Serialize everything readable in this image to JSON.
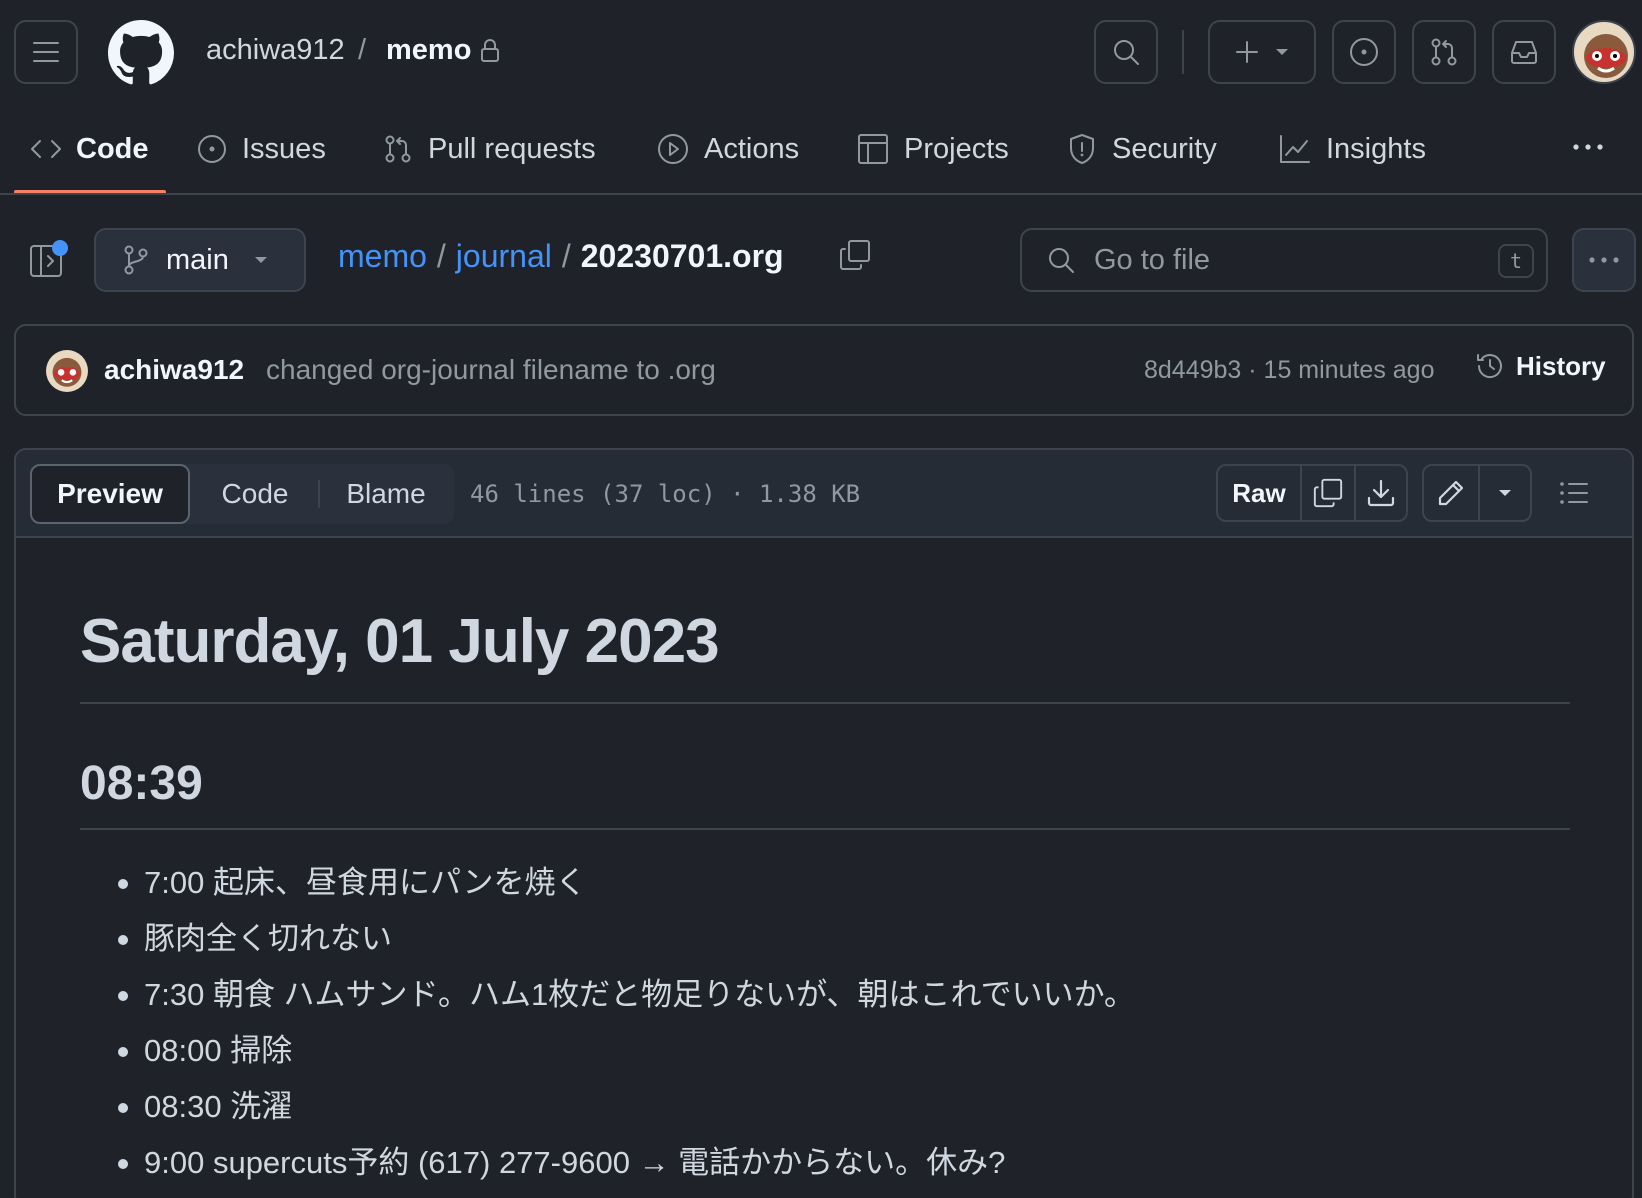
{
  "header": {
    "owner": "achiwa912",
    "separator": "/",
    "repo": "memo"
  },
  "nav": {
    "tabs": [
      {
        "label": "Code",
        "icon": "code-icon",
        "active": true
      },
      {
        "label": "Issues",
        "icon": "issue-opened-icon"
      },
      {
        "label": "Pull requests",
        "icon": "git-pull-request-icon"
      },
      {
        "label": "Actions",
        "icon": "play-icon"
      },
      {
        "label": "Projects",
        "icon": "table-icon"
      },
      {
        "label": "Security",
        "icon": "shield-icon"
      },
      {
        "label": "Insights",
        "icon": "graph-icon"
      }
    ]
  },
  "file_nav": {
    "branch": "main",
    "path": [
      "memo",
      "journal"
    ],
    "path_sep": "/",
    "filename": "20230701.org",
    "goto_placeholder": "Go to file",
    "goto_shortcut": "t"
  },
  "commit": {
    "author": "achiwa912",
    "message": "changed org-journal filename to .org",
    "meta": "8d449b3 · 15 minutes ago",
    "history_label": "History"
  },
  "file_toolbar": {
    "preview_label": "Preview",
    "code_label": "Code",
    "blame_label": "Blame",
    "info": "46 lines (37 loc) · 1.38 KB",
    "raw_label": "Raw"
  },
  "content": {
    "title": "Saturday, 01 July 2023",
    "subtitle": "08:39",
    "items": [
      "7:00 起床、昼食用にパンを焼く",
      "豚肉全く切れない",
      "7:30 朝食 ハムサンド。ハム1枚だと物足りないが、朝はこれでいいか。",
      "08:00 掃除",
      "08:30 洗濯",
      "9:00 supercuts予約 (617) 277-9600 → 電話かからない。休み?"
    ]
  },
  "colors": {
    "background": "#1f2329",
    "link": "#4493f8",
    "tab_underline": "#f78166",
    "notification_dot": "#4493f8"
  }
}
